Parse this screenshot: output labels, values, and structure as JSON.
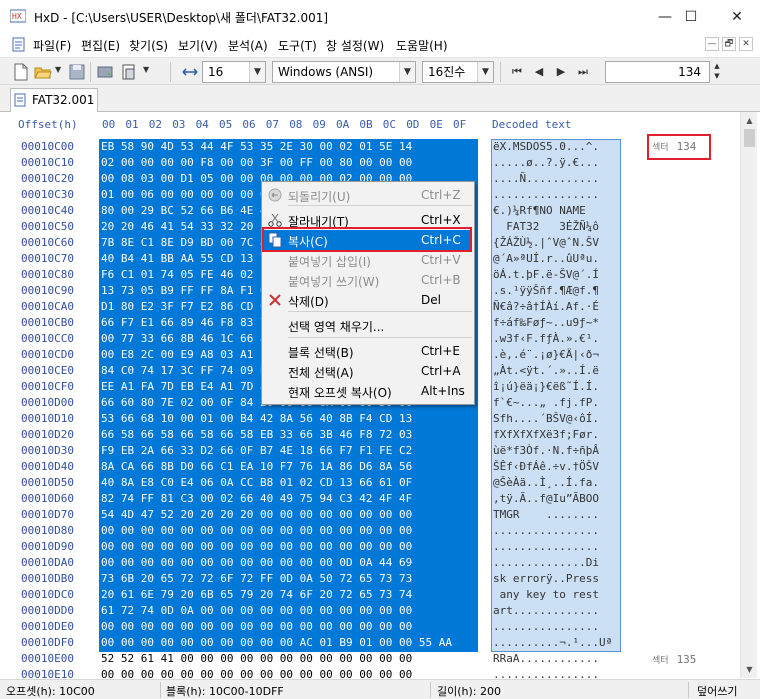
{
  "window": {
    "title": "HxD - [C:\\Users\\USER\\Desktop\\새 폴더\\FAT32.001]",
    "minimize": "—",
    "maximize": "☐",
    "close": "✕"
  },
  "menu": [
    "파일(F)",
    "편집(E)",
    "찾기(S)",
    "보기(V)",
    "분석(A)",
    "도구(T)",
    "창 설정(W)",
    "도움말(H)"
  ],
  "mdi_buttons": [
    "—",
    "🗗",
    "✕"
  ],
  "toolbar": {
    "bytes_per_row": "16",
    "charset": "Windows (ANSI)",
    "offset_base": "16진수",
    "offset_value": "134"
  },
  "tab": {
    "label": "FAT32.001"
  },
  "hex": {
    "header_offset": "Offset(h)",
    "columns": [
      "00",
      "01",
      "02",
      "03",
      "04",
      "05",
      "06",
      "07",
      "08",
      "09",
      "0A",
      "0B",
      "0C",
      "0D",
      "0E",
      "0F"
    ],
    "header_decoded": "Decoded text",
    "rows": [
      {
        "offset": "00010C00",
        "bytes": "EB 58 90 4D 53 44 4F 53 35 2E 30 00 02 01 5E 14",
        "text": "ëX.MSDOS5.0...^."
      },
      {
        "offset": "00010C10",
        "bytes": "02 00 00 00 00 F8 00 00 3F 00 FF 00 80 00 00 00",
        "text": ".....ø..?.ÿ.€..."
      },
      {
        "offset": "00010C20",
        "bytes": "00 08 03 00 D1 05 00 00 00 00 00 00 02 00 00 00",
        "text": "....Ñ..........."
      },
      {
        "offset": "00010C30",
        "bytes": "01 00 06 00 00 00 00 00 00 00 00 00 00 00 00 00",
        "text": "................"
      },
      {
        "offset": "00010C40",
        "bytes": "80 00 29 BC 52 66 B6 4E 4F 20 4E 41 4D 45 20 20",
        "text": "€.)¼Rf¶NO NAME  "
      },
      {
        "offset": "00010C50",
        "bytes": "20 20 46 41 54 33 32 20 20 20 33 C9 8E D1 BC F4",
        "text": "  FAT32   3ÉŽÑ¼ô"
      },
      {
        "offset": "00010C60",
        "bytes": "7B 8E C1 8E D9 BD 00 7C 88 56 40 88 4E 02 8A 56",
        "text": "{ŽÁŽÙ½.|ˆV@ˆN.ŠV"
      },
      {
        "offset": "00010C70",
        "bytes": "40 B4 41 BB AA 55 CD 13 72 10 81 FB 55 AA 75 0A",
        "text": "@´A»ªUÍ.r..ûUªu."
      },
      {
        "offset": "00010C80",
        "bytes": "F6 C1 01 74 05 FE 46 02 EB 2D 8A 56 40 B4 08 CD",
        "text": "öÁ.t.þF.ë-ŠV@´.Í"
      },
      {
        "offset": "00010C90",
        "bytes": "13 73 05 B9 FF FF 8A F1 66 0F B6 C6 40 66 0F B6",
        "text": ".s.¹ÿÿŠñf.¶Æ@f.¶"
      },
      {
        "offset": "00010CA0",
        "bytes": "D1 80 E2 3F F7 E2 86 CD C0 ED 06 41 66 0F B7 C9",
        "text": "Ñ€â?÷â†ÍÀí.Af.·É"
      },
      {
        "offset": "00010CB0",
        "bytes": "66 F7 E1 66 89 46 F8 83 7E 16 00 75 39 83 7E 2A",
        "text": "f÷áf‰Føƒ~..u9ƒ~*"
      },
      {
        "offset": "00010CC0",
        "bytes": "00 77 33 66 8B 46 1C 66 83 C0 0C BB 00 80 B9 01",
        "text": ".w3f‹F.fƒÀ.».€¹."
      },
      {
        "offset": "00010CD0",
        "bytes": "00 E8 2C 00 E9 A8 03 A1 F8 7D 80 C4 7C 8B F0 AC",
        "text": ".è,.é¨.¡ø}€Ä|‹ð¬"
      },
      {
        "offset": "00010CE0",
        "bytes": "84 C0 74 17 3C FF 74 09 B4 0E BB 07 00 CD 10 EB",
        "text": "„Àt.<ÿt.´.»..Í.ë"
      },
      {
        "offset": "00010CF0",
        "bytes": "EE A1 FA 7D EB E4 A1 7D 80 EB DF 98 CD 16 CD 19",
        "text": "î¡ú}ëä¡}€ëß˜Í.Í."
      },
      {
        "offset": "00010D00",
        "bytes": "66 60 80 7E 02 00 0F 84 20 00 66 6A 00 66 50 06",
        "text": "f`€~...„ .fj.fP."
      },
      {
        "offset": "00010D10",
        "bytes": "53 66 68 10 00 01 00 B4 42 8A 56 40 8B F4 CD 13",
        "text": "Sfh....´BŠV@‹ôÍ."
      },
      {
        "offset": "00010D20",
        "bytes": "66 58 66 58 66 58 66 58 EB 33 66 3B 46 F8 72 03",
        "text": "fXfXfXfXë3f;Før."
      },
      {
        "offset": "00010D30",
        "bytes": "F9 EB 2A 66 33 D2 66 0F B7 4E 18 66 F7 F1 FE C2",
        "text": "ùë*f3Òf.·N.f÷ñþÂ"
      },
      {
        "offset": "00010D40",
        "bytes": "8A CA 66 8B D0 66 C1 EA 10 F7 76 1A 86 D6 8A 56",
        "text": "ŠÊf‹ÐfÁê.÷v.†ÖŠV"
      },
      {
        "offset": "00010D50",
        "bytes": "40 8A E8 C0 E4 06 0A CC B8 01 02 CD 13 66 61 0F",
        "text": "@ŠèÀä..Ì¸..Í.fa."
      },
      {
        "offset": "00010D60",
        "bytes": "82 74 FF 81 C3 00 02 66 40 49 75 94 C3 42 4F 4F",
        "text": "‚tÿ.Ã..f@Iu”ÃBOO"
      },
      {
        "offset": "00010D70",
        "bytes": "54 4D 47 52 20 20 20 20 00 00 00 00 00 00 00 00",
        "text": "TMGR    ........"
      },
      {
        "offset": "00010D80",
        "bytes": "00 00 00 00 00 00 00 00 00 00 00 00 00 00 00 00",
        "text": "................"
      },
      {
        "offset": "00010D90",
        "bytes": "00 00 00 00 00 00 00 00 00 00 00 00 00 00 00 00",
        "text": "................"
      },
      {
        "offset": "00010DA0",
        "bytes": "00 00 00 00 00 00 00 00 00 00 00 00 0D 0A 44 69",
        "text": "..............Di"
      },
      {
        "offset": "00010DB0",
        "bytes": "73 6B 20 65 72 72 6F 72 FF 0D 0A 50 72 65 73 73",
        "text": "sk errorÿ..Press"
      },
      {
        "offset": "00010DC0",
        "bytes": "20 61 6E 79 20 6B 65 79 20 74 6F 20 72 65 73 74",
        "text": " any key to rest"
      },
      {
        "offset": "00010DD0",
        "bytes": "61 72 74 0D 0A 00 00 00 00 00 00 00 00 00 00 00",
        "text": "art............."
      },
      {
        "offset": "00010DE0",
        "bytes": "00 00 00 00 00 00 00 00 00 00 00 00 00 00 00 00",
        "text": "................"
      },
      {
        "offset": "00010DF0",
        "bytes": "00 00 00 00 00 00 00 00 00 00 AC 01 B9 01 00 00 55 AA",
        "text": "..........¬.¹...Uª"
      },
      {
        "offset": "00010E00",
        "bytes": "52 52 61 41 00 00 00 00 00 00 00 00 00 00 00 00",
        "text": "RRaA............"
      },
      {
        "offset": "00010E10",
        "bytes": "00 00 00 00 00 00 00 00 00 00 00 00 00 00 00 00",
        "text": "................"
      }
    ],
    "sector_label": "섹터",
    "sector_top": "134",
    "sector_bottom": "135"
  },
  "context_menu": {
    "items": [
      {
        "label": "되돌리기(U)",
        "shortcut": "Ctrl+Z",
        "icon": "undo-icon",
        "disabled": true
      },
      {
        "label": "잘라내기(T)",
        "shortcut": "Ctrl+X",
        "icon": "scissors-icon",
        "disabled": false
      },
      {
        "label": "복사(C)",
        "shortcut": "Ctrl+C",
        "icon": "copy-icon",
        "disabled": false,
        "highlighted": true
      },
      {
        "label": "붙여넣기 삽입(I)",
        "shortcut": "Ctrl+V",
        "icon": "",
        "disabled": true
      },
      {
        "label": "붙여넣기 쓰기(W)",
        "shortcut": "Ctrl+B",
        "icon": "",
        "disabled": true
      },
      {
        "label": "삭제(D)",
        "shortcut": "Del",
        "icon": "delete-icon",
        "disabled": false
      },
      {
        "label": "선택 영역 채우기...",
        "shortcut": "",
        "icon": "",
        "disabled": false
      },
      {
        "label": "블록 선택(B)",
        "shortcut": "Ctrl+E",
        "icon": "",
        "disabled": false
      },
      {
        "label": "전체 선택(A)",
        "shortcut": "Ctrl+A",
        "icon": "",
        "disabled": false
      },
      {
        "label": "현재 오프셋 복사(O)",
        "shortcut": "Alt+Ins",
        "icon": "",
        "disabled": false
      }
    ]
  },
  "statusbar": {
    "offset": "오프셋(h): 10C00",
    "block": "블록(h): 10C00-10DFF",
    "length": "길이(h): 200",
    "mode": "덮어쓰기"
  },
  "colors": {
    "selection": "#0078d7",
    "highlight_box": "#e0202a",
    "offset_text": "#2f4f9e"
  }
}
